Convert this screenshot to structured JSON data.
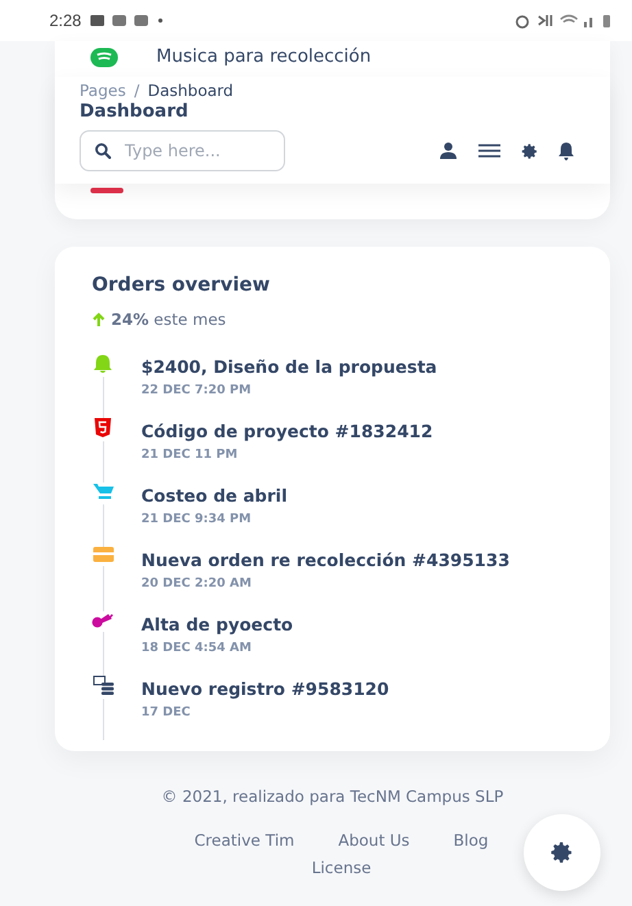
{
  "status_bar": {
    "time": "2:28"
  },
  "top_card": {
    "music_title": "Musica para recolección"
  },
  "navbar": {
    "breadcrumb": [
      "Pages",
      "Dashboard"
    ],
    "separator": "/",
    "title": "Dashboard",
    "search": {
      "placeholder": "Type here..."
    }
  },
  "orders": {
    "title": "Orders overview",
    "trend": {
      "value": "24%",
      "text": "este mes"
    },
    "events": [
      {
        "kind": "bell",
        "color": "#82d616",
        "title": "$2400, Diseño de la propuesta",
        "date": "22 DEC 7:20 PM"
      },
      {
        "kind": "html",
        "color": "#ea0606",
        "title": "Código de proyecto #1832412",
        "date": "21 DEC 11 PM"
      },
      {
        "kind": "cart",
        "color": "#17c1e8",
        "title": "Costeo de abril",
        "date": "21 DEC 9:34 PM"
      },
      {
        "kind": "card",
        "color": "#fbb140",
        "title": "Nueva orden re recolección #4395133",
        "date": "20 DEC 2:20 AM"
      },
      {
        "kind": "key",
        "color": "#cb0c9f",
        "title": "Alta de pyoecto",
        "date": "18 DEC 4:54 AM"
      },
      {
        "kind": "server",
        "color": "#344767",
        "title": "Nuevo registro #9583120",
        "date": "17 DEC"
      }
    ]
  },
  "footer": {
    "copyright": "© 2021, realizado para TecNM Campus SLP",
    "links": [
      "Creative Tim",
      "About Us",
      "Blog",
      "License"
    ]
  }
}
